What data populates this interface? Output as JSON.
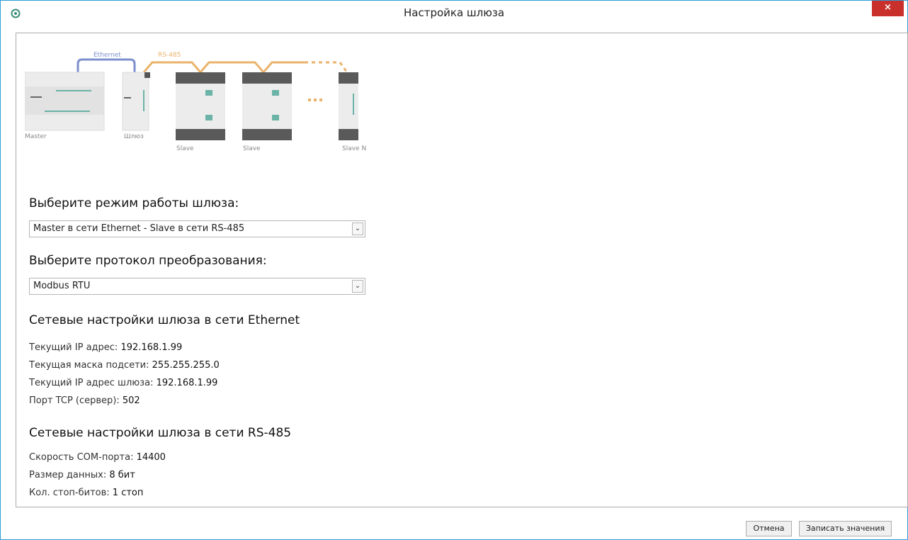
{
  "window": {
    "title": "Настройка шлюза",
    "close_label": "×",
    "accent": "#2b9cd8",
    "close_color": "#c9302c"
  },
  "diagram": {
    "ethernet_label": "Ethernet",
    "rs485_label": "RS-485",
    "ethernet_color": "#7b8fce",
    "rs485_color": "#e9b36b",
    "devices": {
      "master": "Master",
      "gateway": "Шлюз",
      "slave1": "Slave",
      "slave2": "Slave",
      "slaveN": "Slave N"
    }
  },
  "mode": {
    "heading": "Выберите режим работы шлюза:",
    "selected": "Master в сети Ethernet - Slave в сети RS-485"
  },
  "protocol": {
    "heading": "Выберите протокол преобразования:",
    "selected": "Modbus RTU"
  },
  "ethernet": {
    "heading": "Сетевые настройки шлюза в сети Ethernet",
    "items": [
      {
        "label": "Текущий IP адрес:",
        "value": "192.168.1.99"
      },
      {
        "label": "Текущая маска подсети:",
        "value": "255.255.255.0"
      },
      {
        "label": "Текущий IP адрес шлюза:",
        "value": "192.168.1.99"
      },
      {
        "label": "Порт TCP (сервер):",
        "value": "502"
      }
    ]
  },
  "rs485": {
    "heading": "Сетевые настройки шлюза в сети RS-485",
    "items": [
      {
        "label": "Скорость COM-порта:",
        "value": "14400"
      },
      {
        "label": "Размер данных:",
        "value": "8 бит"
      },
      {
        "label": "Кол. стоп-битов:",
        "value": "1 стоп"
      }
    ]
  },
  "footer": {
    "cancel_label": "Отмена",
    "write_label": "Записать значения"
  }
}
